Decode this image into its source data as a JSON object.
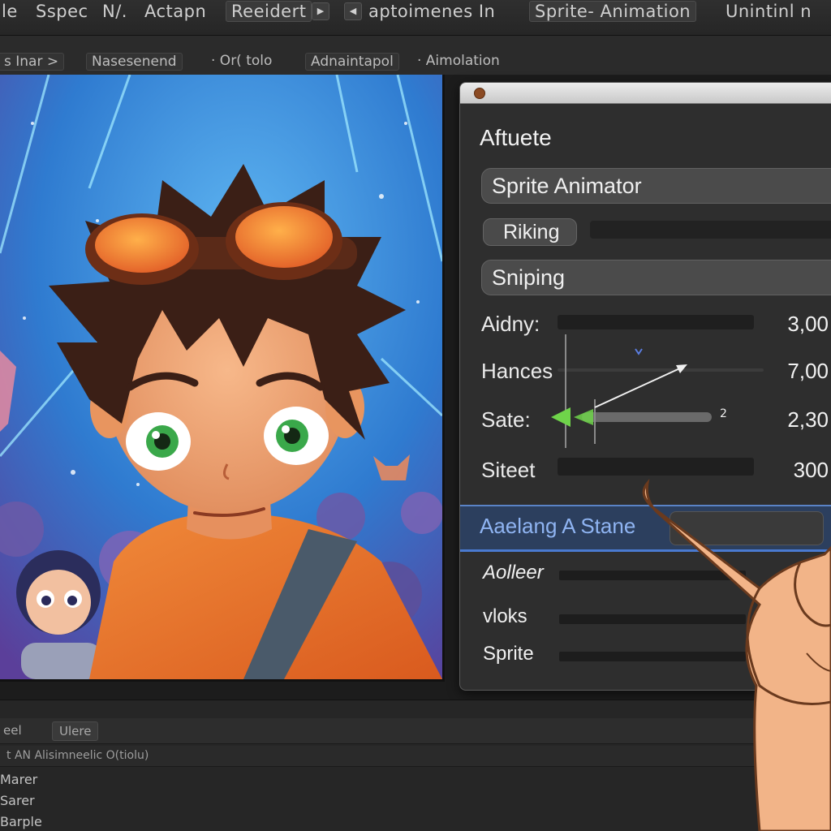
{
  "menu": {
    "items": [
      "le",
      "Sspec",
      "N/.",
      "Actapn",
      "Reeidert",
      "▶",
      "◀",
      "aptoimenes In",
      "Sprite- Animation",
      "Unintinl n"
    ]
  },
  "toolbar": {
    "items": [
      "s Inar >",
      "Nasesenend",
      "· Or( tolo",
      "Adnaintapol",
      "· Aimolation"
    ]
  },
  "panel": {
    "heading": "Aftuete",
    "primary_field": "Sprite Animator",
    "tab_label": "Riking",
    "secondary_field": "Sniping",
    "properties": [
      {
        "label": "Aidny:",
        "value": "3,00"
      },
      {
        "label": "Hances",
        "value": "7,00"
      },
      {
        "label": "Sate:",
        "value": "2,30"
      },
      {
        "label": "Siteet",
        "value": "300"
      }
    ],
    "slider_marker": "2",
    "selected_item": "Aaelang A Stane",
    "list_items": [
      "Aolleer",
      "vloks",
      "Sprite"
    ],
    "accent_color": "#4a7ad0",
    "handle_color": "#6fd44a"
  },
  "timeline": {
    "tabs": [
      "eel",
      "Ulere"
    ],
    "header": "t AN Alisimneelic O(tiolu)",
    "rows": [
      "Marer",
      "Sarer",
      "Barple"
    ]
  },
  "artwork": {
    "character_shirt_color": "#f07a2a",
    "goggle_color": "#e4642a",
    "background_color": "#2f7bd0"
  }
}
